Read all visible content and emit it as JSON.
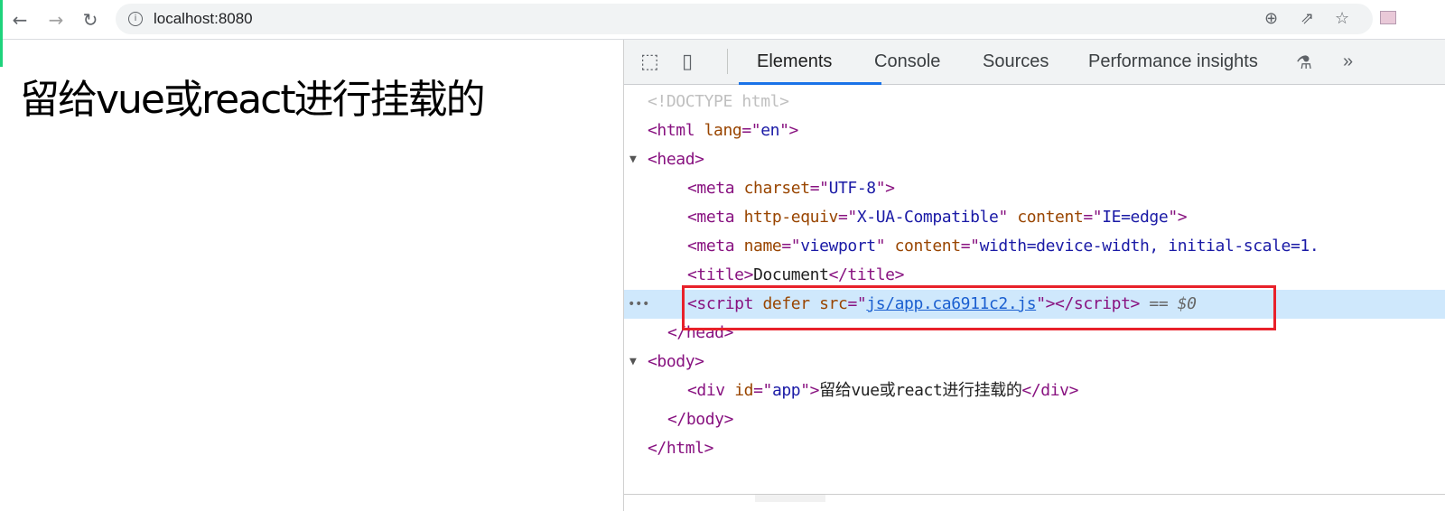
{
  "browser": {
    "url": "localhost:8080",
    "icons": [
      "back-icon",
      "forward-icon",
      "reload-icon",
      "info-icon",
      "zoom-icon",
      "share-icon",
      "star-icon",
      "extension-icon"
    ]
  },
  "page": {
    "text": "留给vue或react进行挂载的"
  },
  "devtools": {
    "tabs": [
      {
        "label": "Elements",
        "active": true
      },
      {
        "label": "Console"
      },
      {
        "label": "Sources"
      },
      {
        "label": "Performance insights"
      }
    ],
    "tree": [
      {
        "indent": 0,
        "tokens": [
          {
            "t": "<!DOCTYPE html>",
            "k": "doc"
          }
        ]
      },
      {
        "indent": 0,
        "tokens": [
          {
            "t": "<html ",
            "k": "tag"
          },
          {
            "t": "lang",
            "k": "attr"
          },
          {
            "t": "=\"",
            "k": "tag"
          },
          {
            "t": "en",
            "k": "val"
          },
          {
            "t": "\">",
            "k": "tag"
          }
        ]
      },
      {
        "indent": 0,
        "triangle": true,
        "tokens": [
          {
            "t": "<head>",
            "k": "tag"
          }
        ]
      },
      {
        "indent": 2,
        "tokens": [
          {
            "t": "<meta ",
            "k": "tag"
          },
          {
            "t": "charset",
            "k": "attr"
          },
          {
            "t": "=\"",
            "k": "tag"
          },
          {
            "t": "UTF-8",
            "k": "val"
          },
          {
            "t": "\">",
            "k": "tag"
          }
        ]
      },
      {
        "indent": 2,
        "tokens": [
          {
            "t": "<meta ",
            "k": "tag"
          },
          {
            "t": "http-equiv",
            "k": "attr"
          },
          {
            "t": "=\"",
            "k": "tag"
          },
          {
            "t": "X-UA-Compatible",
            "k": "val"
          },
          {
            "t": "\" ",
            "k": "tag"
          },
          {
            "t": "content",
            "k": "attr"
          },
          {
            "t": "=\"",
            "k": "tag"
          },
          {
            "t": "IE=edge",
            "k": "val"
          },
          {
            "t": "\">",
            "k": "tag"
          }
        ]
      },
      {
        "indent": 2,
        "tokens": [
          {
            "t": "<meta ",
            "k": "tag"
          },
          {
            "t": "name",
            "k": "attr"
          },
          {
            "t": "=\"",
            "k": "tag"
          },
          {
            "t": "viewport",
            "k": "val"
          },
          {
            "t": "\" ",
            "k": "tag"
          },
          {
            "t": "content",
            "k": "attr"
          },
          {
            "t": "=\"",
            "k": "tag"
          },
          {
            "t": "width=device-width, initial-scale=1.",
            "k": "val"
          }
        ]
      },
      {
        "indent": 2,
        "tokens": [
          {
            "t": "<title>",
            "k": "tag"
          },
          {
            "t": "Document",
            "k": "txt"
          },
          {
            "t": "</title>",
            "k": "tag"
          }
        ]
      },
      {
        "indent": 2,
        "selected": true,
        "tokens": [
          {
            "t": "<script ",
            "k": "tag"
          },
          {
            "t": "defer ",
            "k": "attr"
          },
          {
            "t": "src",
            "k": "attr"
          },
          {
            "t": "=\"",
            "k": "tag"
          },
          {
            "t": "js/app.ca6911c2.js",
            "k": "link"
          },
          {
            "t": "\"></script>",
            "k": "tag"
          },
          {
            "t": " == ",
            "k": "dollar"
          },
          {
            "t": "$0",
            "k": "dollar"
          }
        ]
      },
      {
        "indent": 1,
        "tokens": [
          {
            "t": "</head>",
            "k": "tag"
          }
        ]
      },
      {
        "indent": 0,
        "triangle": true,
        "tokens": [
          {
            "t": "<body>",
            "k": "tag"
          }
        ]
      },
      {
        "indent": 2,
        "tokens": [
          {
            "t": "<div ",
            "k": "tag"
          },
          {
            "t": "id",
            "k": "attr"
          },
          {
            "t": "=\"",
            "k": "tag"
          },
          {
            "t": "app",
            "k": "val"
          },
          {
            "t": "\">",
            "k": "tag"
          },
          {
            "t": "留给vue或react进行挂载的",
            "k": "txt"
          },
          {
            "t": "</div>",
            "k": "tag"
          }
        ]
      },
      {
        "indent": 1,
        "tokens": [
          {
            "t": "</body>",
            "k": "tag"
          }
        ]
      },
      {
        "indent": 0,
        "tokens": [
          {
            "t": "</html>",
            "k": "tag"
          }
        ]
      }
    ],
    "highlight_color": "#e8212a"
  }
}
